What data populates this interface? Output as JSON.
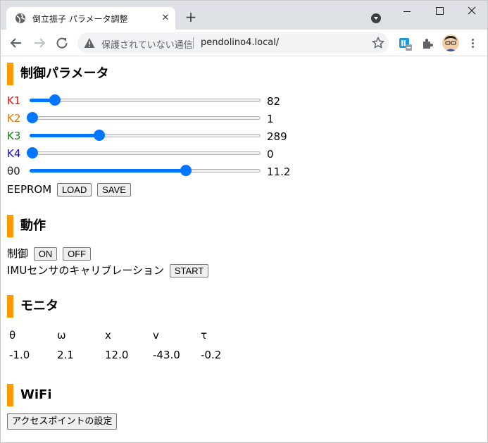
{
  "browser": {
    "tab_title": "倒立振子 パラメータ調整",
    "tab_close": "✕",
    "new_tab": "+",
    "security_text": "保護されていない通信",
    "url": "pendolino4.local/"
  },
  "sections": {
    "control": "制御パラメータ",
    "operation": "動作",
    "monitor": "モニタ",
    "wifi": "WiFi"
  },
  "params": [
    {
      "label": "K1",
      "value": "82",
      "fraction": 0.1,
      "color": "#e01010"
    },
    {
      "label": "K2",
      "value": "1",
      "fraction": 0.0,
      "color": "#e07800"
    },
    {
      "label": "K3",
      "value": "289",
      "fraction": 0.3,
      "color": "#108010"
    },
    {
      "label": "K4",
      "value": "0",
      "fraction": 0.0,
      "color": "#1010d0"
    },
    {
      "label": "θ0",
      "value": "11.2",
      "fraction": 0.69,
      "color": "#202020"
    }
  ],
  "eeprom": {
    "label": "EEPROM",
    "load": "LOAD",
    "save": "SAVE"
  },
  "operation": {
    "control_label": "制御",
    "on": "ON",
    "off": "OFF",
    "imu_label": "IMUセンサのキャリブレーション",
    "start": "START"
  },
  "monitor": {
    "headers": [
      "θ",
      "ω",
      "x",
      "v",
      "τ"
    ],
    "values": [
      "-1.0",
      "2.1",
      "12.0",
      "-43.0",
      "-0.2"
    ]
  },
  "wifi": {
    "button": "アクセスポイントの設定"
  }
}
